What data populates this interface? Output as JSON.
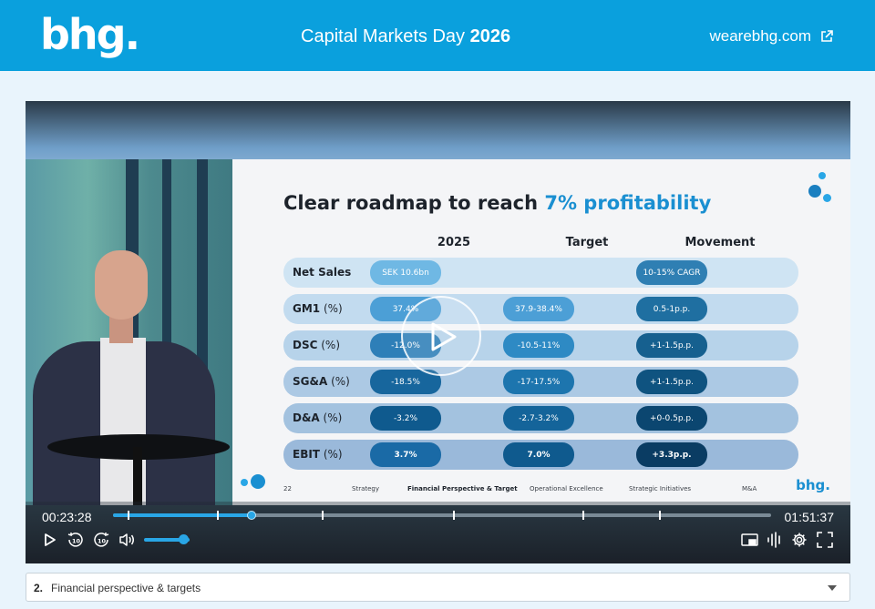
{
  "header": {
    "logo_text": "bhg",
    "logo_dot": ".",
    "event_title": "Capital Markets Day",
    "event_year": "2026",
    "site_link": "wearebhg.com",
    "bg_color": "#0aa0dd"
  },
  "slide": {
    "title_main": "Clear roadmap to reach",
    "title_accent": "7% profitability",
    "columns": [
      "2025",
      "Target",
      "Movement"
    ],
    "rows": [
      {
        "label_bold": "Net Sales",
        "label_rest": "",
        "v2025": "SEK 10.6bn",
        "target": "",
        "movement": "10-15% CAGR"
      },
      {
        "label_bold": "GM1",
        "label_rest": " (%)",
        "v2025": "37.4%",
        "target": "37.9-38.4%",
        "movement": "0.5-1p.p."
      },
      {
        "label_bold": "DSC",
        "label_rest": " (%)",
        "v2025": "-12.0%",
        "target": "-10.5-11%",
        "movement": "+1-1.5p.p."
      },
      {
        "label_bold": "SG&A",
        "label_rest": " (%)",
        "v2025": "-18.5%",
        "target": "-17-17.5%",
        "movement": "+1-1.5p.p."
      },
      {
        "label_bold": "D&A",
        "label_rest": " (%)",
        "v2025": "-3.2%",
        "target": "-2.7-3.2%",
        "movement": "+0-0.5p.p."
      },
      {
        "label_bold": "EBIT",
        "label_rest": " (%)",
        "v2025": "3.7%",
        "target": "7.0%",
        "movement": "+3.3p.p."
      }
    ],
    "footer": {
      "page": "22",
      "items": [
        "Strategy",
        "Financial Perspective & Target",
        "Operational Excellence",
        "Strategic Initiatives",
        "M&A"
      ],
      "active": "Financial Perspective & Target"
    },
    "logo": "bhg."
  },
  "player": {
    "current_time": "00:23:28",
    "duration": "01:51:37",
    "progress": 0.211,
    "volume": 0.85,
    "accent_color": "#29a6e6"
  },
  "chapter": {
    "number": "2.",
    "label": "Financial perspective & targets"
  }
}
